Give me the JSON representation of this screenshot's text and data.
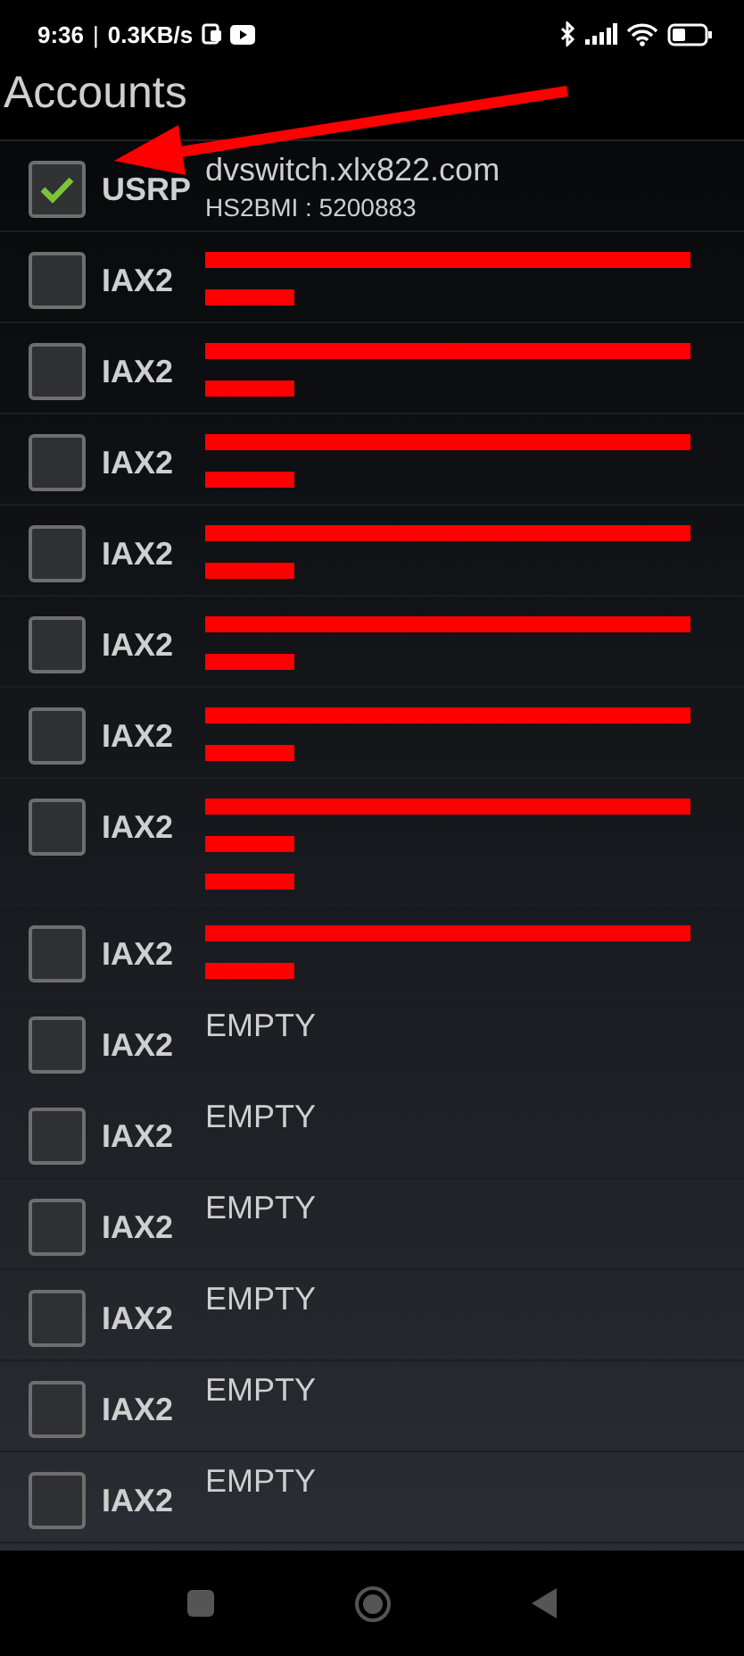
{
  "status_bar": {
    "time": "9:36",
    "separator": "|",
    "speed": "0.3KB/s"
  },
  "title": "Accounts",
  "annotation": {
    "kind": "arrow"
  },
  "accounts": [
    {
      "protocol": "USRP",
      "checked": true,
      "lines": [
        {
          "kind": "text",
          "text": "dvswitch.xlx822.com"
        },
        {
          "kind": "subtext",
          "text": "HS2BMI : 5200883"
        }
      ]
    },
    {
      "protocol": "IAX2",
      "checked": false,
      "lines": [
        {
          "kind": "redacted"
        },
        {
          "kind": "redacted"
        }
      ]
    },
    {
      "protocol": "IAX2",
      "checked": false,
      "lines": [
        {
          "kind": "redacted"
        },
        {
          "kind": "redacted"
        }
      ]
    },
    {
      "protocol": "IAX2",
      "checked": false,
      "lines": [
        {
          "kind": "redacted"
        },
        {
          "kind": "redacted"
        }
      ]
    },
    {
      "protocol": "IAX2",
      "checked": false,
      "lines": [
        {
          "kind": "redacted"
        },
        {
          "kind": "redacted"
        }
      ]
    },
    {
      "protocol": "IAX2",
      "checked": false,
      "lines": [
        {
          "kind": "redacted"
        },
        {
          "kind": "redacted"
        }
      ]
    },
    {
      "protocol": "IAX2",
      "checked": false,
      "lines": [
        {
          "kind": "redacted"
        },
        {
          "kind": "redacted"
        }
      ]
    },
    {
      "protocol": "IAX2",
      "checked": false,
      "lines": [
        {
          "kind": "redacted"
        },
        {
          "kind": "redacted"
        },
        {
          "kind": "redacted"
        }
      ]
    },
    {
      "protocol": "IAX2",
      "checked": false,
      "lines": [
        {
          "kind": "redacted"
        },
        {
          "kind": "redacted"
        }
      ]
    },
    {
      "protocol": "IAX2",
      "checked": false,
      "lines": [
        {
          "kind": "text",
          "text": "EMPTY"
        }
      ]
    },
    {
      "protocol": "IAX2",
      "checked": false,
      "lines": [
        {
          "kind": "text",
          "text": "EMPTY"
        }
      ]
    },
    {
      "protocol": "IAX2",
      "checked": false,
      "lines": [
        {
          "kind": "text",
          "text": "EMPTY"
        }
      ]
    },
    {
      "protocol": "IAX2",
      "checked": false,
      "lines": [
        {
          "kind": "text",
          "text": "EMPTY"
        }
      ]
    },
    {
      "protocol": "IAX2",
      "checked": false,
      "lines": [
        {
          "kind": "text",
          "text": "EMPTY"
        }
      ]
    },
    {
      "protocol": "IAX2",
      "checked": false,
      "lines": [
        {
          "kind": "text",
          "text": "EMPTY"
        }
      ]
    }
  ]
}
